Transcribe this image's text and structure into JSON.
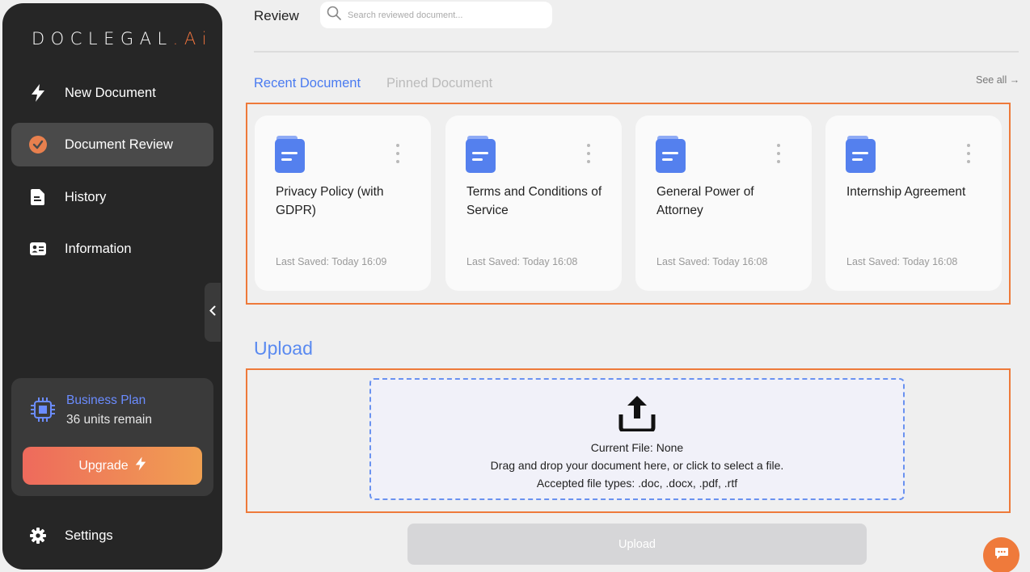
{
  "brand": {
    "logo_main": "DOCLEGAL",
    "logo_suffix": ".Ai",
    "accent": "#f0743e"
  },
  "sidebar": {
    "items": [
      {
        "label": "New Document",
        "icon": "lightning-icon"
      },
      {
        "label": "Document Review",
        "icon": "check-circle-icon",
        "active": true
      },
      {
        "label": "History",
        "icon": "file-icon"
      },
      {
        "label": "Information",
        "icon": "id-card-icon"
      }
    ],
    "plan": {
      "name": "Business Plan",
      "units": "36 units remain",
      "upgrade_label": "Upgrade"
    },
    "settings_label": "Settings"
  },
  "header": {
    "title": "Review",
    "search_placeholder": "Search reviewed document..."
  },
  "tabs": {
    "recent": "Recent Document",
    "pinned": "Pinned Document",
    "see_all": "See all →"
  },
  "cards": [
    {
      "title": "Privacy Policy (with GDPR)",
      "saved": "Last Saved: Today 16:09"
    },
    {
      "title": "Terms and Conditions of Service",
      "saved": "Last Saved: Today 16:08"
    },
    {
      "title": "General Power of Attorney",
      "saved": "Last Saved: Today 16:08"
    },
    {
      "title": "Internship Agreement",
      "saved": "Last Saved: Today 16:08"
    }
  ],
  "upload": {
    "heading": "Upload",
    "current_file": "Current File: None",
    "instructions": "Drag and drop your document here, or click to select a file.",
    "accepted": "Accepted file types: .doc, .docx, .pdf, .rtf",
    "button_label": "Upload"
  },
  "colors": {
    "primary_blue": "#4a7bf0",
    "highlight_orange": "#ee7a3a",
    "sidebar_bg": "#262626"
  }
}
